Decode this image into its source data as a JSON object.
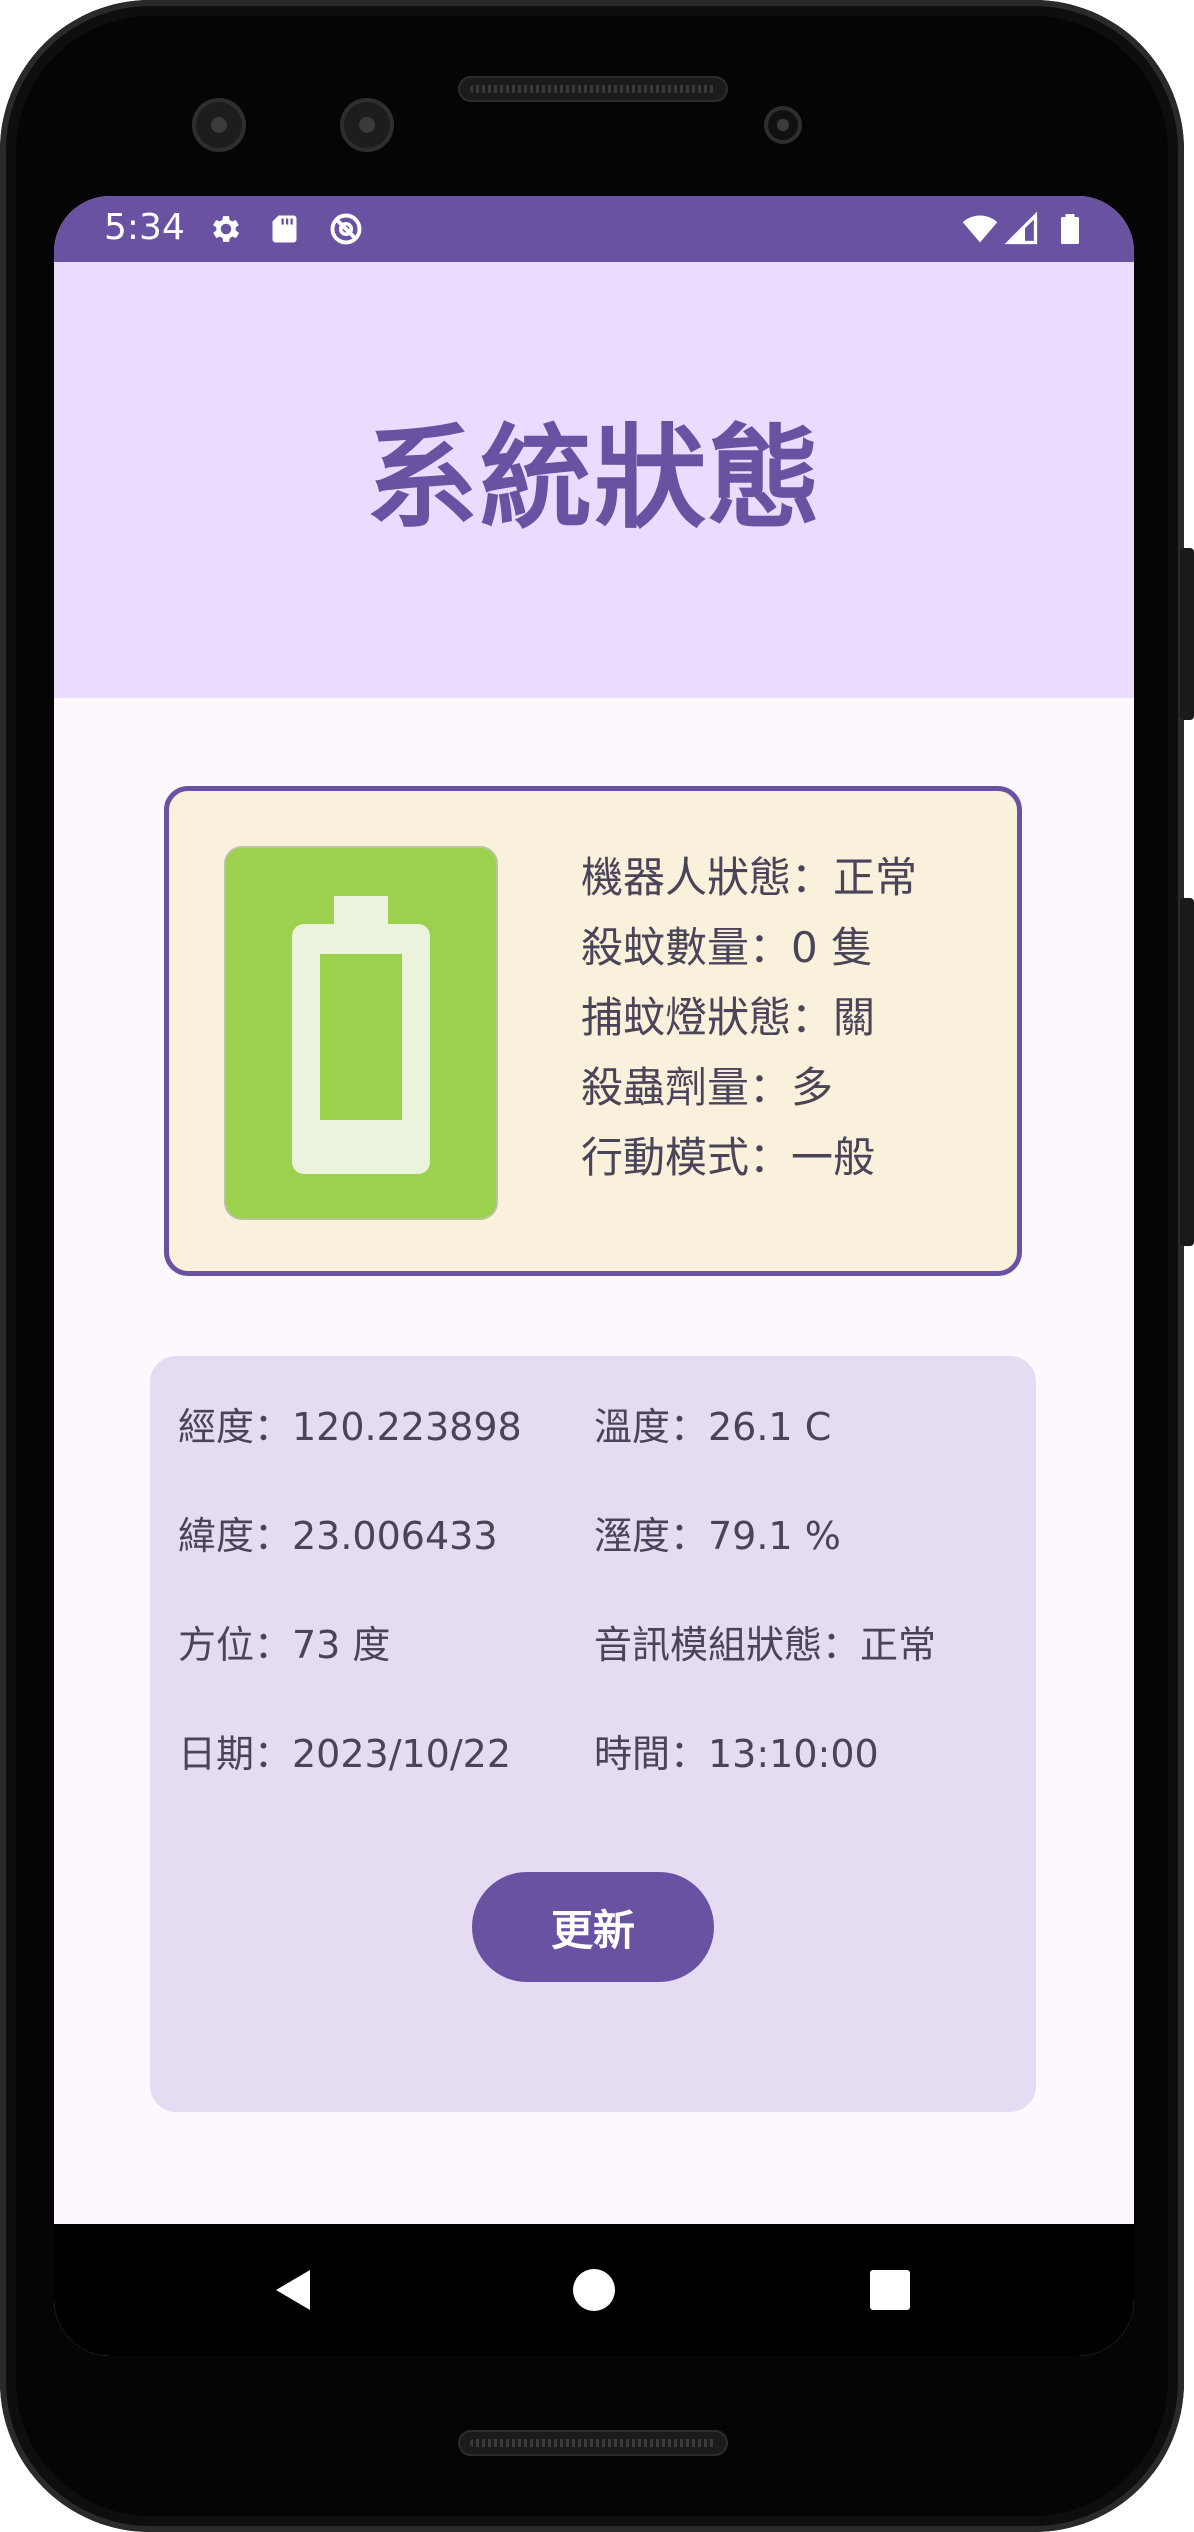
{
  "status_bar": {
    "time": "5:34",
    "left_icons": [
      "gear-icon",
      "sd-card-icon",
      "at-sign-icon"
    ],
    "right_icons": [
      "wifi-icon",
      "cell-signal-icon",
      "battery-icon"
    ],
    "color": "#6a52a3"
  },
  "header": {
    "title": "系統狀態",
    "background": "#e9dcfe"
  },
  "status_card": {
    "battery_icon": "battery-icon",
    "lines": [
      "機器人狀態：正常",
      "殺蚊數量：0 隻",
      "捕蚊燈狀態：關",
      "殺蟲劑量：多",
      "行動模式：一般"
    ],
    "background": "#faf1dc",
    "border_color": "#6a52a3"
  },
  "info_panel": {
    "longitude": "經度：120.223898",
    "temperature": "溫度：26.1 C",
    "latitude": "緯度：23.006433",
    "humidity": "溼度：79.1 %",
    "heading": "方位：73 度",
    "audio_module": "音訊模組狀態：正常",
    "date": "日期：2023/10/22",
    "time": "時間：13:10:00",
    "update_label": "更新",
    "background": "#e5dcf4"
  },
  "nav_bar": {
    "buttons": [
      "back-icon",
      "home-icon",
      "recents-icon"
    ]
  },
  "colors": {
    "accent": "#6a52a3",
    "battery_green": "#9cd14d"
  }
}
